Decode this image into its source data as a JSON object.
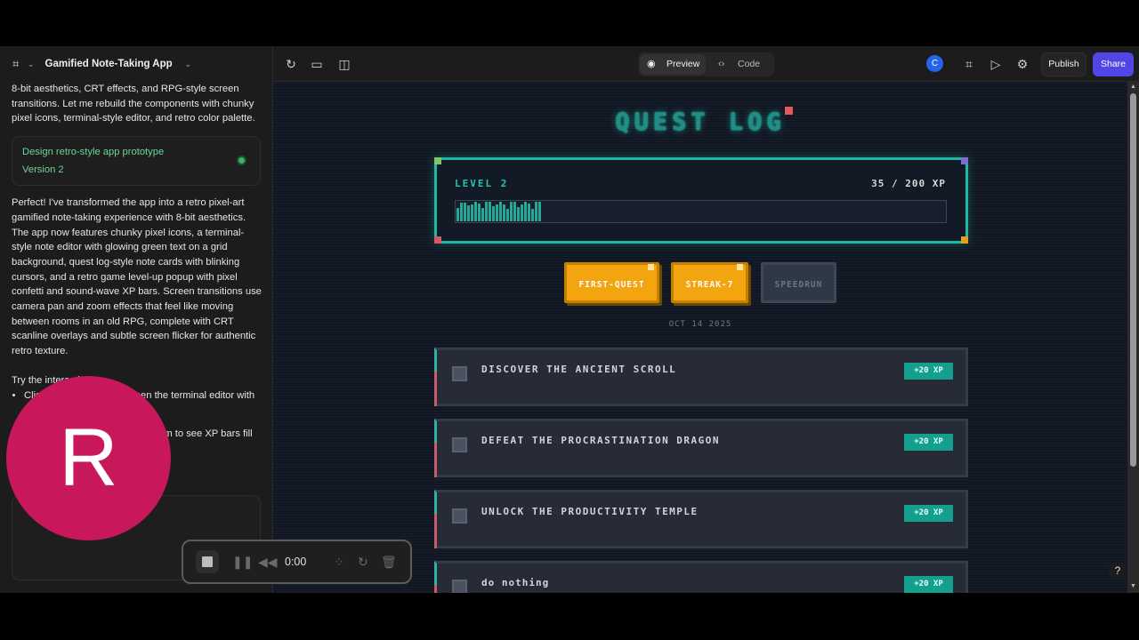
{
  "header": {
    "project_title": "Gamified Note-Taking App"
  },
  "chat": {
    "intro_text": "8-bit aesthetics, CRT effects, and RPG-style screen transitions. Let me rebuild the components with chunky pixel icons, terminal-style editor, and retro color palette.",
    "version_card": {
      "title": "Design retro-style app prototype",
      "version": "Version 2"
    },
    "response_text": "Perfect! I've transformed the app into a retro pixel-art gamified note-taking experience with 8-bit aesthetics. The app now features chunky pixel icons, a terminal-style note editor with glowing green text on a grid background, quest log-style note cards with blinking cursors, and a retro game level-up popup with pixel confetti and sound-wave XP bars. Screen transitions use camera pan and zoom effects that feel like moving between rooms in an old RPG, complete with CRT scanline overlays and subtle screen flicker for authentic retro texture.",
    "try_heading": "Try the interactions:",
    "bullets": [
      "Click \"NEW QUEST\" to open the terminal editor with typing animations",
      "Complete quests by clicking them to see XP bars fill with wave animations"
    ]
  },
  "overlay": {
    "avatar_letter": "R"
  },
  "toolbar": {
    "preview_label": "Preview",
    "code_label": "Code",
    "user_initial": "C",
    "publish_label": "Publish",
    "share_label": "Share"
  },
  "recorder": {
    "time": "0:00"
  },
  "help": {
    "label": "?"
  },
  "game": {
    "title": "QUEST LOG",
    "level_label": "LEVEL 2",
    "xp_text": "35 / 200 XP",
    "xp_current": 35,
    "xp_max": 200,
    "badges": [
      {
        "label": "FIRST-QUEST",
        "earned": true
      },
      {
        "label": "STREAK-7",
        "earned": true
      },
      {
        "label": "SPEEDRUN",
        "earned": false
      }
    ],
    "date": "OCT 14 2025",
    "notes": [
      {
        "title": "DISCOVER THE ANCIENT SCROLL",
        "xp": "+20 XP"
      },
      {
        "title": "DEFEAT THE PROCRASTINATION DRAGON",
        "xp": "+20 XP"
      },
      {
        "title": "UNLOCK THE PRODUCTIVITY TEMPLE",
        "xp": "+20 XP"
      },
      {
        "title": "do nothing",
        "xp": "+20 XP"
      }
    ]
  },
  "colors": {
    "accent_teal": "#1fb8a6",
    "badge_gold": "#f2a50f",
    "share_blue": "#4f46e5",
    "avatar_magenta": "#c8175a",
    "status_green": "#3bb36b"
  }
}
